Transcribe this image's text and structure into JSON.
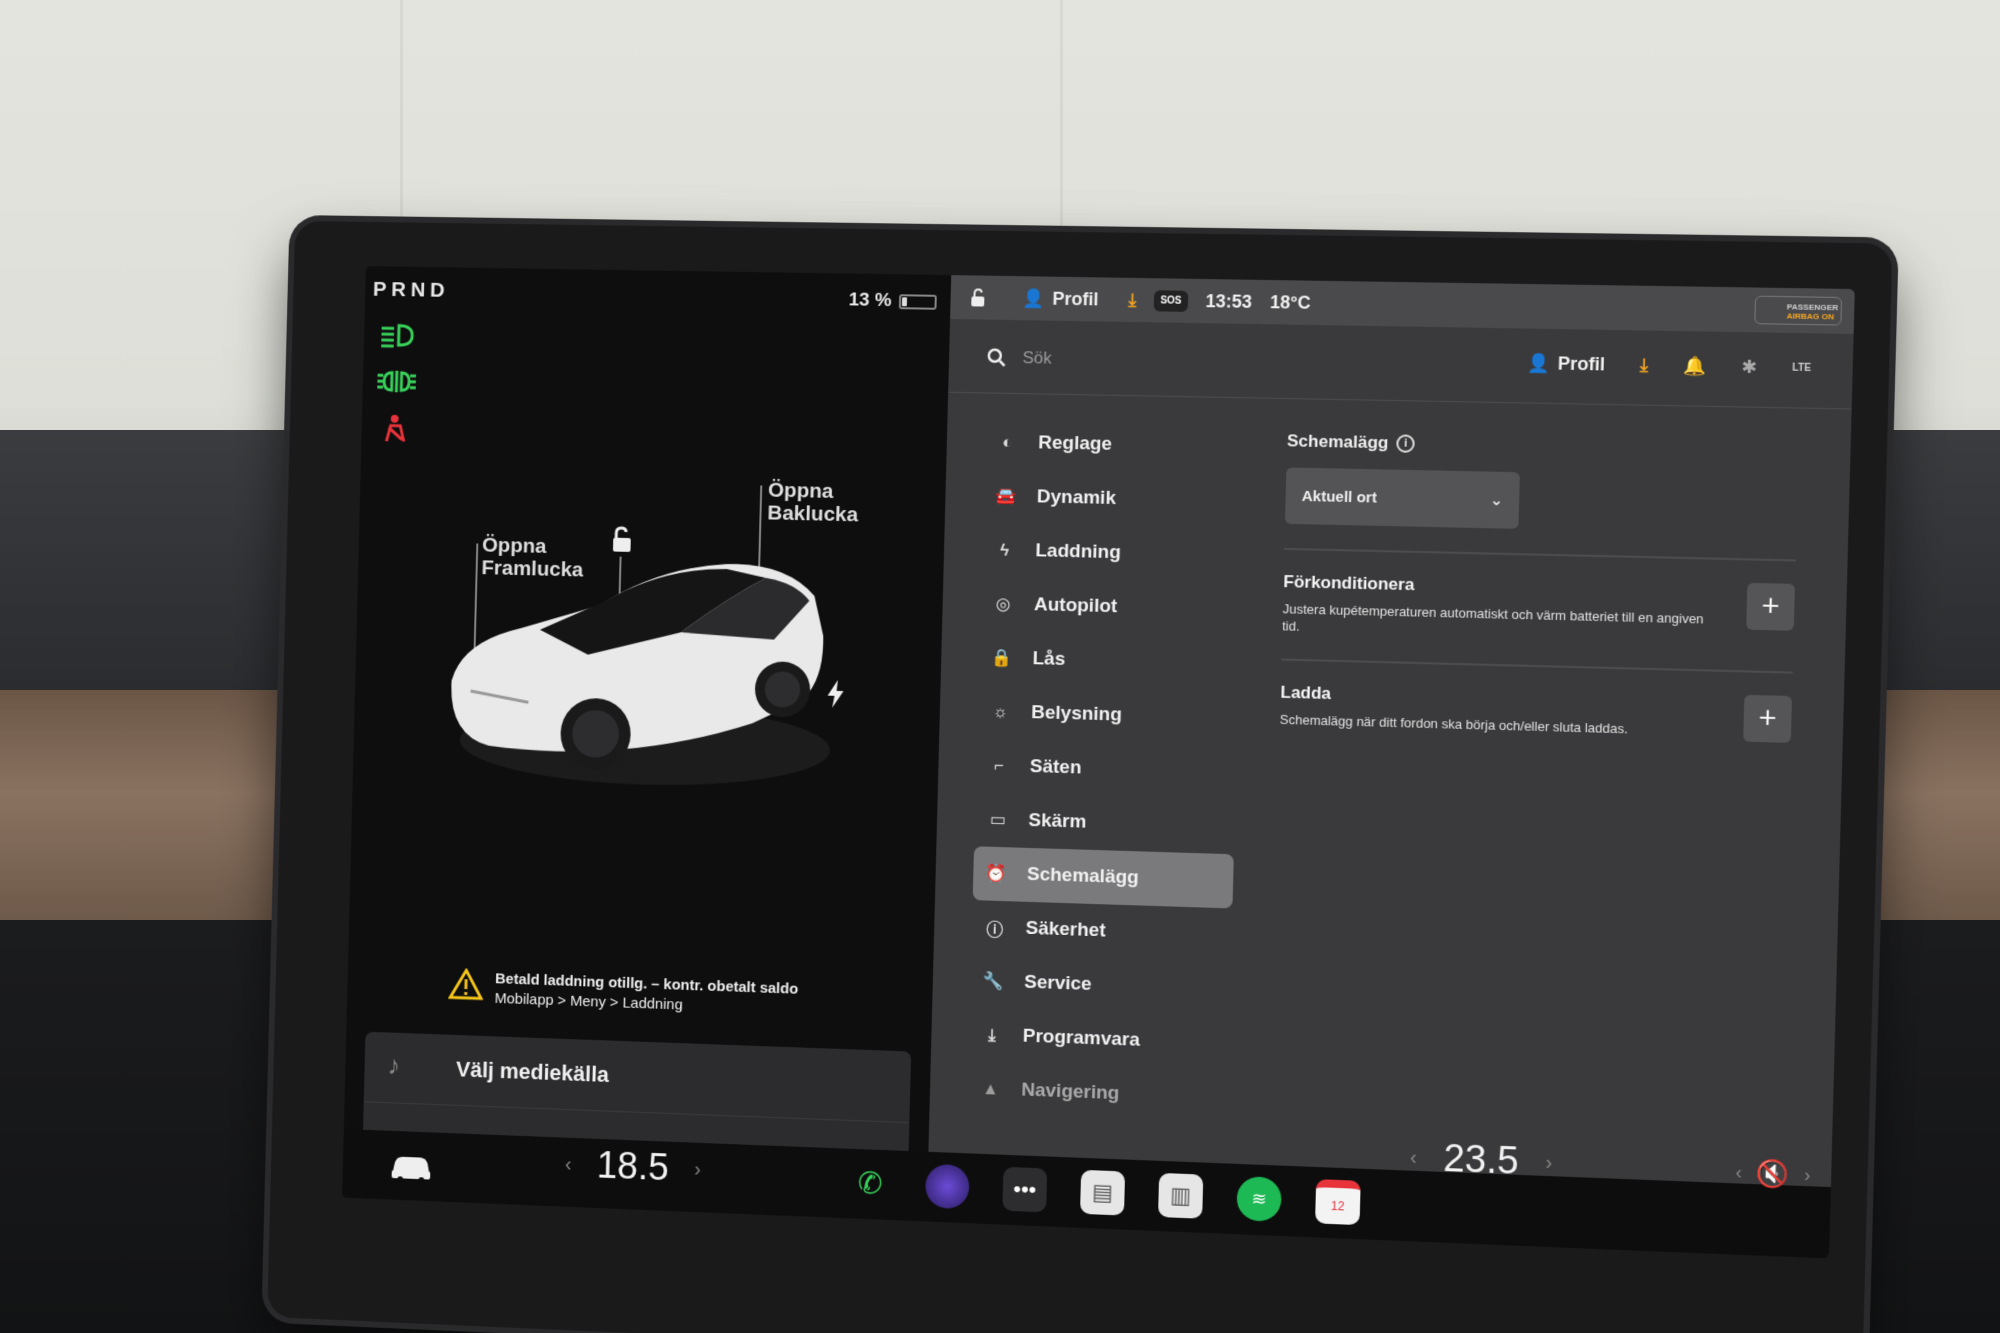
{
  "gear": "PRND",
  "battery": {
    "percent_label": "13 %",
    "level": 0.13
  },
  "callouts": {
    "frunk": {
      "line1": "Öppna",
      "line2": "Framlucka"
    },
    "trunk": {
      "line1": "Öppna",
      "line2": "Baklucka"
    }
  },
  "warning": {
    "title": "Betald laddning otillg. – kontr. obetalt saldo",
    "path": "Mobilapp > Meny > Laddning"
  },
  "media": {
    "source_label": "Välj mediekälla"
  },
  "statusbar": {
    "profile": "Profil",
    "sos": "SOS",
    "time": "13:53",
    "outside_temp": "18°C",
    "airbag_line1": "PASSENGER",
    "airbag_line2": "AIRBAG ON"
  },
  "topbar": {
    "search_placeholder": "Sök",
    "profile": "Profil",
    "network": "LTE"
  },
  "menu": [
    {
      "label": "Reglage",
      "icon": "toggle-icon"
    },
    {
      "label": "Dynamik",
      "icon": "car-icon"
    },
    {
      "label": "Laddning",
      "icon": "bolt-icon"
    },
    {
      "label": "Autopilot",
      "icon": "steering-wheel-icon"
    },
    {
      "label": "Lås",
      "icon": "lock-icon"
    },
    {
      "label": "Belysning",
      "icon": "sun-icon"
    },
    {
      "label": "Säten",
      "icon": "seat-icon"
    },
    {
      "label": "Skärm",
      "icon": "display-icon"
    },
    {
      "label": "Schemalägg",
      "icon": "clock-icon",
      "active": true
    },
    {
      "label": "Säkerhet",
      "icon": "alert-circle-icon"
    },
    {
      "label": "Service",
      "icon": "wrench-icon"
    },
    {
      "label": "Programvara",
      "icon": "download-icon"
    },
    {
      "label": "Navigering",
      "icon": "navigation-icon"
    }
  ],
  "schedule": {
    "heading": "Schemalägg",
    "location": "Aktuell ort",
    "precondition": {
      "title": "Förkonditionera",
      "desc": "Justera kupétemperaturen automatiskt och värm batteriet till en angiven tid."
    },
    "charge": {
      "title": "Ladda",
      "desc": "Schemalägg när ditt fordon ska börja och/eller sluta laddas."
    }
  },
  "climate": {
    "driver_temp": "18.5",
    "passenger_temp": "23.5"
  },
  "dock": {
    "calendar_day": "12"
  },
  "colors": {
    "accent_orange": "#f5a623",
    "indicator_green": "#38d15a",
    "indicator_red": "#e8333a",
    "spotify_green": "#1db954"
  }
}
